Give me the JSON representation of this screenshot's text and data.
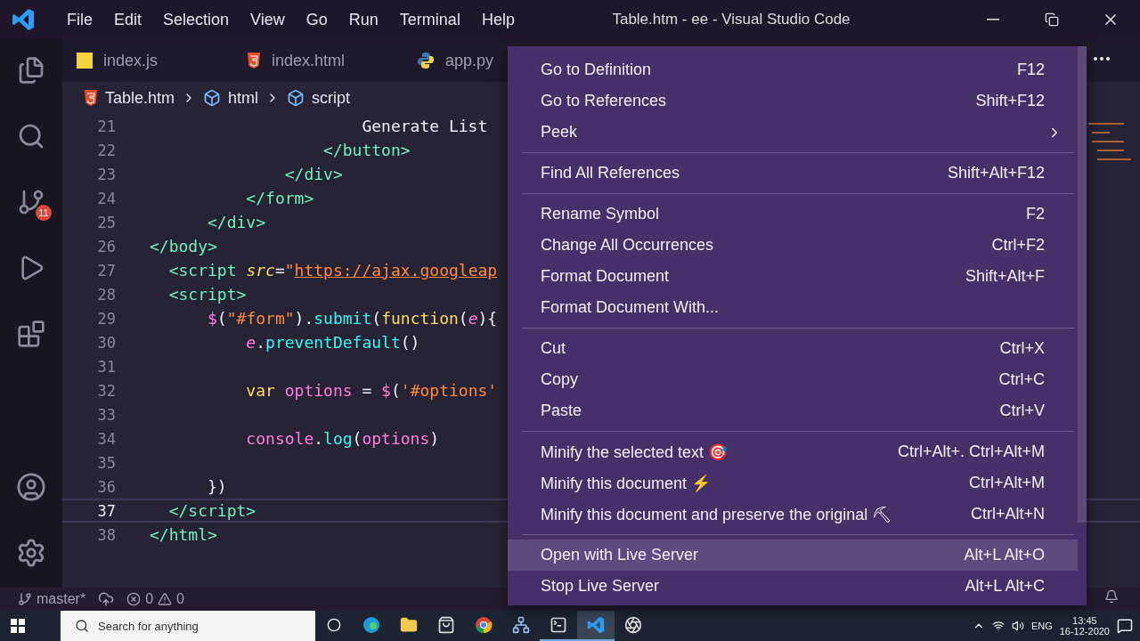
{
  "title_bar": {
    "menu": [
      "File",
      "Edit",
      "Selection",
      "View",
      "Go",
      "Run",
      "Terminal",
      "Help"
    ],
    "title": "Table.htm - ee - Visual Studio Code"
  },
  "activity_bar": {
    "source_control_badge": "11"
  },
  "tabs": [
    {
      "label": "index.js",
      "kind": "js"
    },
    {
      "label": "index.html",
      "kind": "html"
    },
    {
      "label": "app.py",
      "kind": "python"
    }
  ],
  "breadcrumbs": [
    {
      "label": "Table.htm",
      "kind": "file"
    },
    {
      "label": "html",
      "kind": "element"
    },
    {
      "label": "script",
      "kind": "element"
    }
  ],
  "code_lines": [
    {
      "number": "21",
      "current": false,
      "tokens": [
        {
          "text": "                      Generate List",
          "kind": "plain"
        }
      ]
    },
    {
      "number": "22",
      "current": false,
      "tokens": [
        {
          "text": "                  </button>",
          "kind": "tag"
        }
      ]
    },
    {
      "number": "23",
      "current": false,
      "tokens": [
        {
          "text": "              </div>",
          "kind": "tag"
        }
      ]
    },
    {
      "number": "24",
      "current": false,
      "tokens": [
        {
          "text": "          </form>",
          "kind": "tag"
        }
      ]
    },
    {
      "number": "25",
      "current": false,
      "tokens": [
        {
          "text": "      </div>",
          "kind": "tag"
        }
      ]
    },
    {
      "number": "26",
      "current": false,
      "tokens": [
        {
          "text": "</body>",
          "kind": "tag"
        }
      ]
    },
    {
      "number": "27",
      "current": false,
      "tokens": [
        {
          "text": "  <script ",
          "kind": "tag"
        },
        {
          "text": "src",
          "kind": "attr"
        },
        {
          "text": "=",
          "kind": "punct"
        },
        {
          "text": "\"",
          "kind": "string"
        },
        {
          "text": "https://ajax.googleap",
          "kind": "link"
        }
      ]
    },
    {
      "number": "28",
      "current": false,
      "tokens": [
        {
          "text": "  <script>",
          "kind": "tag"
        }
      ]
    },
    {
      "number": "29",
      "current": false,
      "tokens": [
        {
          "text": "      $",
          "kind": "var"
        },
        {
          "text": "(",
          "kind": "punct"
        },
        {
          "text": "\"#form\"",
          "kind": "string"
        },
        {
          "text": ").",
          "kind": "punct"
        },
        {
          "text": "submit",
          "kind": "func"
        },
        {
          "text": "(",
          "kind": "punct"
        },
        {
          "text": "function",
          "kind": "keyword"
        },
        {
          "text": "(",
          "kind": "punct"
        },
        {
          "text": "e",
          "kind": "param"
        },
        {
          "text": "){",
          "kind": "punct"
        }
      ]
    },
    {
      "number": "30",
      "current": false,
      "tokens": [
        {
          "text": "          e",
          "kind": "param"
        },
        {
          "text": ".",
          "kind": "punct"
        },
        {
          "text": "preventDefault",
          "kind": "func"
        },
        {
          "text": "()",
          "kind": "punct"
        }
      ]
    },
    {
      "number": "31",
      "current": false
    },
    {
      "number": "32",
      "current": false,
      "tokens": [
        {
          "text": "          var",
          "kind": "keyword"
        },
        {
          "text": " options",
          "kind": "var"
        },
        {
          "text": " = ",
          "kind": "punct"
        },
        {
          "text": "$",
          "kind": "var"
        },
        {
          "text": "(",
          "kind": "punct"
        },
        {
          "text": "'#options'",
          "kind": "string"
        }
      ]
    },
    {
      "number": "33",
      "current": false
    },
    {
      "number": "34",
      "current": false,
      "tokens": [
        {
          "text": "          console",
          "kind": "var"
        },
        {
          "text": ".",
          "kind": "punct"
        },
        {
          "text": "log",
          "kind": "func"
        },
        {
          "text": "(",
          "kind": "punct"
        },
        {
          "text": "options",
          "kind": "var"
        },
        {
          "text": ")",
          "kind": "punct"
        }
      ]
    },
    {
      "number": "35",
      "current": false
    },
    {
      "number": "36",
      "current": false,
      "tokens": [
        {
          "text": "      })",
          "kind": "punct"
        }
      ]
    },
    {
      "number": "37",
      "current": true,
      "tokens": [
        {
          "text": "  </script>",
          "kind": "tag"
        }
      ]
    },
    {
      "number": "38",
      "current": false,
      "tokens": [
        {
          "text": "</html>",
          "kind": "tag"
        }
      ]
    }
  ],
  "context_menu": {
    "groups": [
      [
        {
          "label": "Go to Definition",
          "shortcut": "F12",
          "submenu": false,
          "selected": false
        },
        {
          "label": "Go to References",
          "shortcut": "Shift+F12",
          "submenu": false,
          "selected": false
        },
        {
          "label": "Peek",
          "submenu": true,
          "selected": false
        }
      ],
      [
        {
          "label": "Find All References",
          "shortcut": "Shift+Alt+F12",
          "submenu": false,
          "selected": false
        }
      ],
      [
        {
          "label": "Rename Symbol",
          "shortcut": "F2",
          "submenu": false,
          "selected": false
        },
        {
          "label": "Change All Occurrences",
          "shortcut": "Ctrl+F2",
          "submenu": false,
          "selected": false
        },
        {
          "label": "Format Document",
          "shortcut": "Shift+Alt+F",
          "submenu": false,
          "selected": false
        },
        {
          "label": "Format Document With...",
          "submenu": false,
          "selected": false
        }
      ],
      [
        {
          "label": "Cut",
          "shortcut": "Ctrl+X",
          "submenu": false,
          "selected": false
        },
        {
          "label": "Copy",
          "shortcut": "Ctrl+C",
          "submenu": false,
          "selected": false
        },
        {
          "label": "Paste",
          "shortcut": "Ctrl+V",
          "submenu": false,
          "selected": false
        }
      ],
      [
        {
          "label": "Minify the selected text 🎯",
          "shortcut": "Ctrl+Alt+. Ctrl+Alt+M",
          "submenu": false,
          "selected": false
        },
        {
          "label": "Minify this document ⚡",
          "shortcut": "Ctrl+Alt+M",
          "submenu": false,
          "selected": false
        },
        {
          "label": "Minify this document and preserve the original ⛏",
          "shortcut": "Ctrl+Alt+N",
          "submenu": false,
          "selected": false
        }
      ],
      [
        {
          "label": "Open with Live Server",
          "shortcut": "Alt+L Alt+O",
          "submenu": false,
          "selected": true
        },
        {
          "label": "Stop Live Server",
          "shortcut": "Alt+L Alt+C",
          "submenu": false,
          "selected": false
        }
      ]
    ]
  },
  "status_bar": {
    "branch": "master*",
    "errors": "0",
    "warnings": "0"
  },
  "taskbar": {
    "search_placeholder": "Search for anything",
    "language": "ENG",
    "time": "13:45",
    "date": "16-12-2020"
  }
}
